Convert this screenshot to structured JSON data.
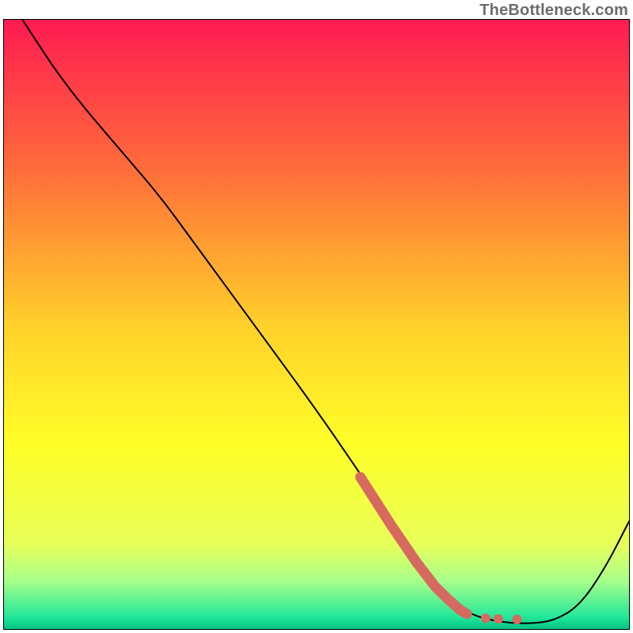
{
  "watermark": "TheBottleneck.com",
  "chart_data": {
    "type": "line",
    "title": "",
    "xlabel": "",
    "ylabel": "",
    "xlim": [
      0,
      100
    ],
    "ylim": [
      0,
      100
    ],
    "grid": false,
    "axes_visible": false,
    "background_gradient": {
      "stops": [
        {
          "pos": 0.0,
          "color": "#ff1a52"
        },
        {
          "pos": 0.25,
          "color": "#ff6e3a"
        },
        {
          "pos": 0.5,
          "color": "#ffd02a"
        },
        {
          "pos": 0.7,
          "color": "#ffff28"
        },
        {
          "pos": 0.86,
          "color": "#e8ff5a"
        },
        {
          "pos": 0.92,
          "color": "#a8ff8a"
        },
        {
          "pos": 0.98,
          "color": "#20e69a"
        },
        {
          "pos": 1.0,
          "color": "#00c080"
        }
      ]
    },
    "series": [
      {
        "name": "bottleneck-curve",
        "stroke": "#000000",
        "stroke_width": 2,
        "x": [
          3,
          10,
          20,
          25,
          30,
          40,
          50,
          58,
          60,
          64,
          67,
          70,
          73,
          76,
          80,
          84,
          88,
          92,
          96,
          100
        ],
        "y": [
          100,
          89,
          77,
          71,
          64,
          50,
          36,
          24,
          21,
          14,
          10,
          6,
          3.5,
          2,
          1.2,
          1,
          1.5,
          4,
          10,
          18
        ]
      }
    ],
    "highlight_segment": {
      "name": "optimal-zone",
      "color": "#d66a60",
      "x": [
        57,
        62,
        66,
        69,
        71,
        73,
        74
      ],
      "y": [
        25,
        17,
        11,
        7,
        5,
        3.2,
        2.6
      ],
      "extra_dots": {
        "x": [
          77,
          79,
          82
        ],
        "y": [
          1.9,
          1.8,
          1.7
        ]
      }
    }
  }
}
